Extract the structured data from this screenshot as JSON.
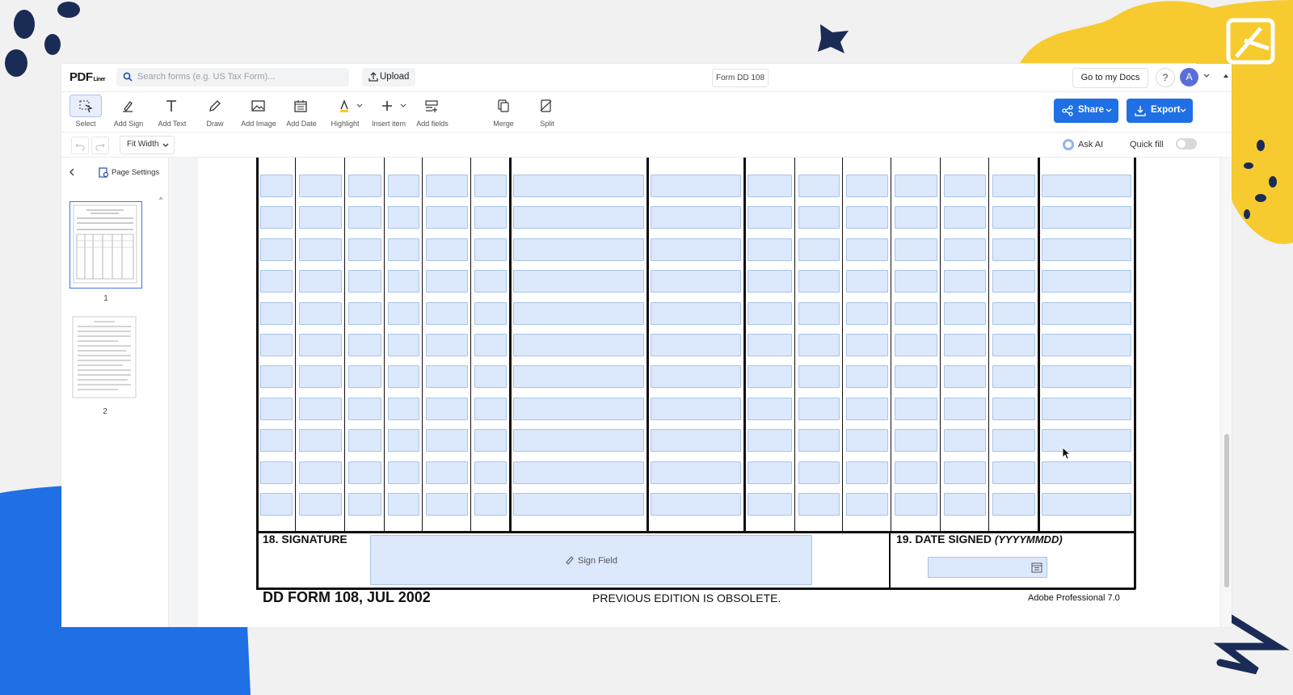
{
  "app": {
    "logo_main": "PDF",
    "logo_sub": "Liner",
    "search_placeholder": "Search forms (e.g. US Tax Form)...",
    "upload_label": "Upload",
    "document_name": "Form DD 108",
    "go_to_docs_label": "Go to my Docs",
    "help_label": "?",
    "avatar_initial": "A",
    "accent_color": "#1f6fe5"
  },
  "toolbar": {
    "tools": [
      {
        "label": "Select",
        "icon": "select-cursor-icon"
      },
      {
        "label": "Add Sign",
        "icon": "signature-pen-icon"
      },
      {
        "label": "Add Text",
        "icon": "text-icon"
      },
      {
        "label": "Draw",
        "icon": "pen-draw-icon"
      },
      {
        "label": "Add Image",
        "icon": "image-icon"
      },
      {
        "label": "Add Date",
        "icon": "calendar-icon"
      },
      {
        "label": "Highlight",
        "icon": "highlighter-icon"
      },
      {
        "label": "Insert item",
        "icon": "plus-icon"
      },
      {
        "label": "Add fields",
        "icon": "fields-icon"
      },
      {
        "label": "Merge",
        "icon": "merge-icon"
      },
      {
        "label": "Split",
        "icon": "split-icon"
      }
    ],
    "share_label": "Share",
    "export_label": "Export"
  },
  "subbar": {
    "zoom_label": "Fit Width",
    "ask_ai_label": "Ask AI",
    "quick_fill_label": "Quick fill",
    "quick_fill_on": false
  },
  "sidebar": {
    "page_settings_label": "Page Settings",
    "pages": [
      {
        "number": "1",
        "selected": true
      },
      {
        "number": "2",
        "selected": false
      }
    ]
  },
  "form": {
    "signature_label": "18. SIGNATURE",
    "sign_field_label": "Sign Field",
    "date_signed_label": "19. DATE SIGNED",
    "date_signed_format": "(YYYYMMDD)",
    "footer_form": "DD FORM 108, JUL 2002",
    "footer_obsolete": "PREVIOUS EDITION IS OBSOLETE.",
    "footer_software": "Adobe Professional 7.0",
    "visible_field_rows": 11
  }
}
